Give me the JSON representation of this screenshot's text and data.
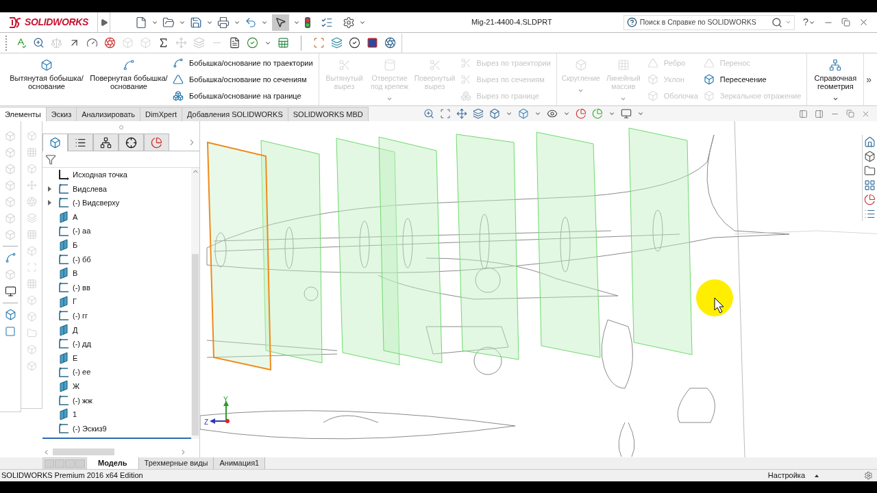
{
  "app": {
    "logo": "SOLIDWORKS",
    "title": "Mig-21-4400-4.SLDPRT",
    "search_placeholder": "Поиск в Справке по SOLIDWORKS",
    "help": "?"
  },
  "ribbon": {
    "sections": [
      [
        {
          "kind": "large",
          "items": [
            {
              "label": "Вытянутая бобышка/основание",
              "enabled": true,
              "menu": false
            },
            {
              "label": "Повернутая бобышка/основание",
              "enabled": true,
              "menu": false
            }
          ]
        },
        {
          "kind": "small",
          "items": [
            {
              "label": "Бобышка/основание по траектории",
              "enabled": true
            },
            {
              "label": "Бобышка/основание по сечениям",
              "enabled": true
            },
            {
              "label": "Бобышка/основание на границе",
              "enabled": true
            }
          ]
        }
      ],
      [
        {
          "kind": "large",
          "items": [
            {
              "label": "Вытянутый вырез",
              "enabled": false,
              "menu": false
            },
            {
              "label": "Отверстие под крепеж",
              "enabled": false,
              "menu": true
            },
            {
              "label": "Повернутый вырез",
              "enabled": false,
              "menu": false
            }
          ]
        },
        {
          "kind": "small",
          "items": [
            {
              "label": "Вырез по траектории",
              "enabled": false
            },
            {
              "label": "Вырез по сечениям",
              "enabled": false
            },
            {
              "label": "Вырез по границе",
              "enabled": false
            }
          ]
        }
      ],
      [
        {
          "kind": "large",
          "items": [
            {
              "label": "Скругление",
              "enabled": false,
              "menu": true
            },
            {
              "label": "Линейный массив",
              "enabled": false,
              "menu": true
            }
          ]
        },
        {
          "kind": "small",
          "items": [
            {
              "label": "Ребро",
              "enabled": false
            },
            {
              "label": "Уклон",
              "enabled": false
            },
            {
              "label": "Оболочка",
              "enabled": false
            }
          ]
        },
        {
          "kind": "small",
          "items": [
            {
              "label": "Перенос",
              "enabled": false
            },
            {
              "label": "Пересечение",
              "enabled": true
            },
            {
              "label": "Зеркальное отражение",
              "enabled": false
            }
          ]
        }
      ],
      [
        {
          "kind": "large",
          "items": [
            {
              "label": "Справочная геометрия",
              "enabled": true,
              "menu": true
            }
          ]
        }
      ]
    ],
    "more": "»"
  },
  "tabs": [
    {
      "label": "Элементы",
      "selected": true
    },
    {
      "label": "Эскиз",
      "selected": false
    },
    {
      "label": "Анализировать",
      "selected": false
    },
    {
      "label": "DimXpert",
      "selected": false
    },
    {
      "label": "Добавления SOLIDWORKS",
      "selected": false
    },
    {
      "label": "SOLIDWORKS MBD",
      "selected": false
    }
  ],
  "tree": [
    {
      "label": "Исходная точка",
      "kind": "origin",
      "expandable": false
    },
    {
      "label": "Видслева",
      "kind": "sketch",
      "expandable": true
    },
    {
      "label": "(-) Видсверху",
      "kind": "sketch",
      "expandable": true
    },
    {
      "label": "А",
      "kind": "plane",
      "expandable": false
    },
    {
      "label": "(-) аа",
      "kind": "sketch",
      "expandable": false
    },
    {
      "label": "Б",
      "kind": "plane",
      "expandable": false
    },
    {
      "label": "(-) бб",
      "kind": "sketch",
      "expandable": false
    },
    {
      "label": "В",
      "kind": "plane",
      "expandable": false
    },
    {
      "label": "(-) вв",
      "kind": "sketch",
      "expandable": false
    },
    {
      "label": "Г",
      "kind": "plane",
      "expandable": false
    },
    {
      "label": "(-) гг",
      "kind": "sketch",
      "expandable": false
    },
    {
      "label": "Д",
      "kind": "plane",
      "expandable": false
    },
    {
      "label": "(-) дд",
      "kind": "sketch",
      "expandable": false
    },
    {
      "label": "Е",
      "kind": "plane",
      "expandable": false
    },
    {
      "label": "(-) ее",
      "kind": "sketch",
      "expandable": false
    },
    {
      "label": "Ж",
      "kind": "plane",
      "expandable": false
    },
    {
      "label": "(-) жж",
      "kind": "sketch",
      "expandable": false
    },
    {
      "label": "1",
      "kind": "plane",
      "expandable": false
    },
    {
      "label": "(-) Эскиз9",
      "kind": "sketch",
      "expandable": false
    }
  ],
  "viewport": {
    "axis_labels": [
      "Y",
      "Z"
    ]
  },
  "panel_tabs": [
    {
      "selected": true
    },
    {
      "selected": false
    },
    {
      "selected": false
    },
    {
      "selected": false
    },
    {
      "selected": false
    }
  ],
  "bottom_tabs": [
    {
      "label": "Модель",
      "selected": true
    },
    {
      "label": "Трехмерные виды",
      "selected": false
    },
    {
      "label": "Анимация1",
      "selected": false
    }
  ],
  "status_bar": {
    "edition": "SOLIDWORKS Premium 2016 x64 Edition",
    "customize": "Настройка"
  }
}
